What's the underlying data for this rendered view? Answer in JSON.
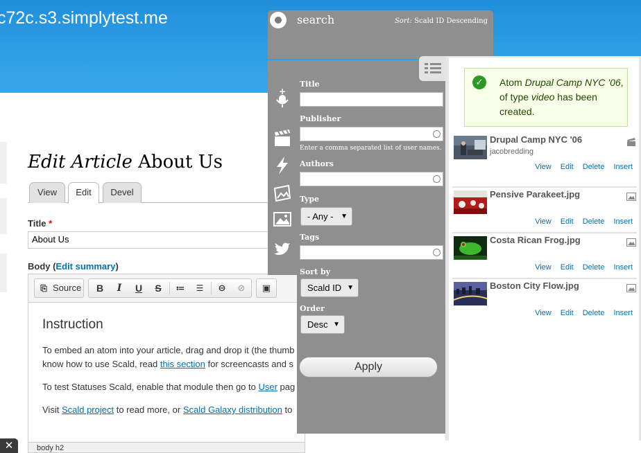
{
  "site": {
    "name": "c72c.s3.simplytest.me"
  },
  "page": {
    "title_em": "Edit Article",
    "title_rest": "About Us",
    "tabs": [
      {
        "label": "View"
      },
      {
        "label": "Edit"
      },
      {
        "label": "Devel"
      }
    ]
  },
  "form": {
    "title_label": "Title",
    "required_mark": "*",
    "title_value": "About Us",
    "body_label": "Body",
    "edit_summary_label": "Edit summary",
    "source_label": "Source"
  },
  "editor": {
    "heading": "Instruction",
    "p1_line1_text": "To embed an atom into your article, drag and drop it (the thumb",
    "p1_line2_pre": "know how to use Scald, read ",
    "p1_line2_link": "this section",
    "p1_line2_post": " for screencasts and s",
    "p2_pre": "To test Statuses Scald, enable that module then go to ",
    "p2_link": "User",
    "p2_post": " pag",
    "p3_pre": "Visit ",
    "p3_link1": "Scald project",
    "p3_mid": " to read more, or ",
    "p3_link2": "Scald Galaxy distribution",
    "p3_post": " to",
    "status_path": "body  h2"
  },
  "search": {
    "label": "search",
    "sort_key": "Sort:",
    "sort_value": "Scald ID Descending"
  },
  "filters": {
    "title_label": "Title",
    "publisher_label": "Publisher",
    "publisher_hint": "Enter a comma separated list of user names.",
    "authors_label": "Authors",
    "type_label": "Type",
    "type_value": "- Any -",
    "tags_label": "Tags",
    "sortby_label": "Sort by",
    "sortby_value": "Scald ID",
    "order_label": "Order",
    "order_value": "Desc",
    "apply_label": "Apply"
  },
  "message": {
    "pre": "Atom ",
    "atom_name": "Drupal Camp NYC '06",
    "mid": ", of type ",
    "atom_type": "video",
    "post": " has been created."
  },
  "atoms": [
    {
      "title": "Drupal Camp NYC '06",
      "author": "jacobredding",
      "type_icon": "video-icon",
      "actions": [
        "View",
        "Edit",
        "Delete",
        "Insert"
      ]
    },
    {
      "title": "Pensive Parakeet.jpg",
      "author": "",
      "type_icon": "image-icon",
      "actions": [
        "View",
        "Edit",
        "Delete",
        "Insert"
      ]
    },
    {
      "title": "Costa Rican Frog.jpg",
      "author": "",
      "type_icon": "image-icon",
      "actions": [
        "View",
        "Edit",
        "Delete",
        "Insert"
      ]
    },
    {
      "title": "Boston City Flow.jpg",
      "author": "",
      "type_icon": "image-icon",
      "actions": [
        "View",
        "Edit",
        "Delete",
        "Insert"
      ]
    }
  ],
  "colors": {
    "header_blue": "#2f9fe6",
    "panel_gray": "#8f8f8f",
    "link_blue": "#0071b3",
    "message_green": "#2b9a24"
  }
}
